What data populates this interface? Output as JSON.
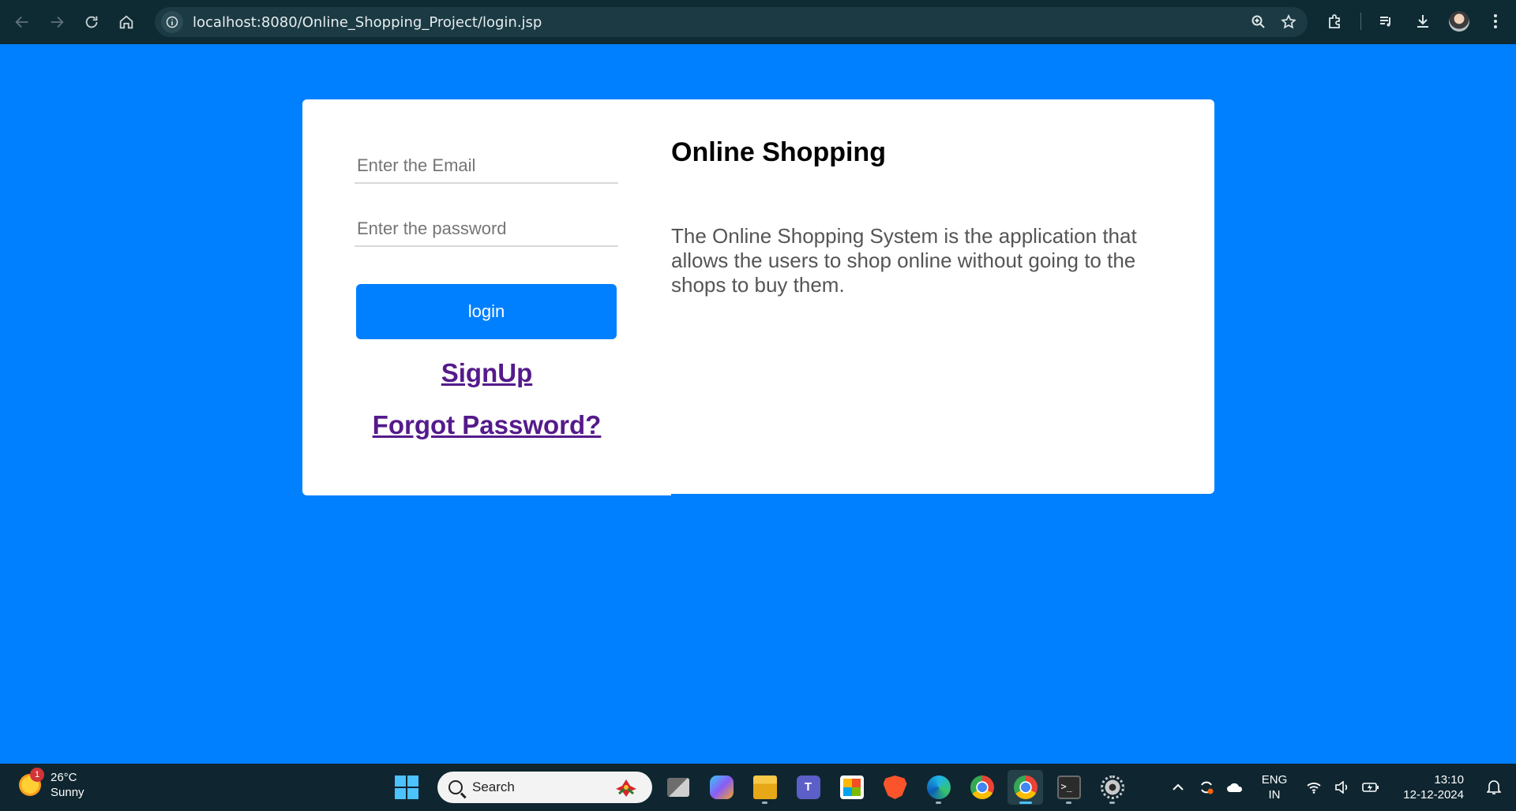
{
  "browser": {
    "url": "localhost:8080/Online_Shopping_Project/login.jsp"
  },
  "login": {
    "email_placeholder": "Enter the Email",
    "password_placeholder": "Enter the password",
    "login_label": "login",
    "signup_label": "SignUp",
    "forgot_label": "Forgot Password?"
  },
  "info": {
    "title": "Online Shopping",
    "description": "The Online Shopping System is the application that allows the users to shop online without going to the shops to buy them."
  },
  "taskbar": {
    "weather_temp": "26°C",
    "weather_cond": "Sunny",
    "weather_badge": "1",
    "search_label": "Search",
    "lang_top": "ENG",
    "lang_bottom": "IN",
    "time": "13:10",
    "date": "12-12-2024"
  },
  "colors": {
    "page_bg": "#0080ff",
    "button_bg": "#0080ff",
    "link": "#551a8b",
    "browser_bar": "#0e2a33",
    "taskbar": "#0f2630"
  }
}
